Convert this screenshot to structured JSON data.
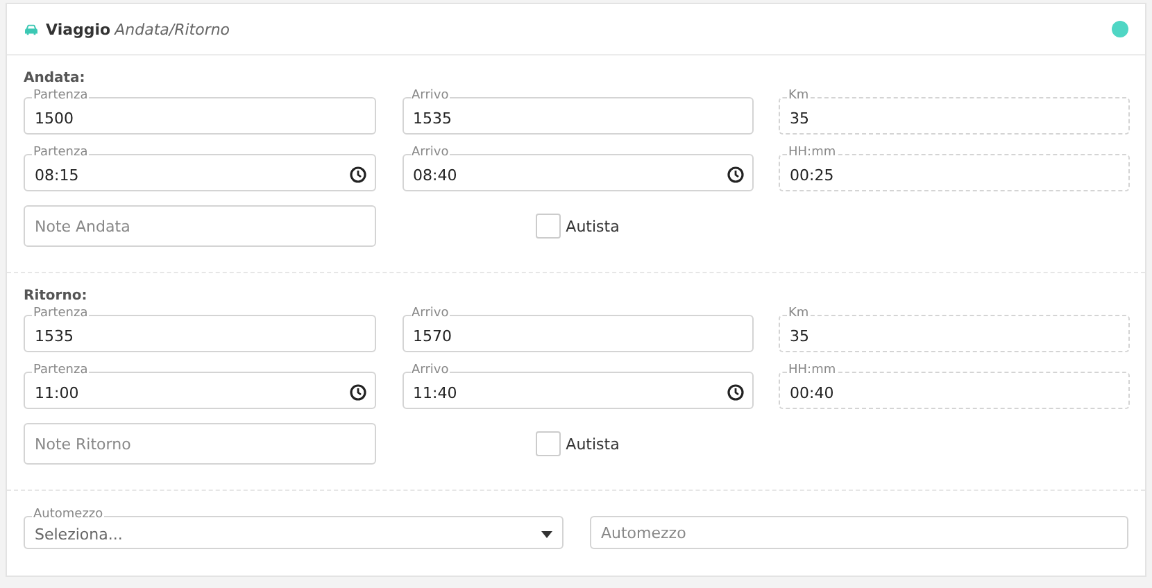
{
  "card": {
    "title": "Viaggio",
    "subtitle": "Andata/Ritorno"
  },
  "sections": [
    {
      "title": "Andata:",
      "rows": [
        [
          {
            "kind": "text",
            "label": "Partenza",
            "value": "1500"
          },
          {
            "kind": "text",
            "label": "Arrivo",
            "value": "1535"
          },
          {
            "kind": "computed",
            "label": "Km",
            "value": "35"
          }
        ],
        [
          {
            "kind": "time",
            "label": "Partenza",
            "value": "08:15"
          },
          {
            "kind": "time",
            "label": "Arrivo",
            "value": "08:40"
          },
          {
            "kind": "computed",
            "label": "HH:mm",
            "value": "00:25"
          }
        ]
      ],
      "note": {
        "placeholder": "Note Andata"
      },
      "checkbox": {
        "label": "Autista",
        "checked": false
      }
    },
    {
      "title": "Ritorno:",
      "rows": [
        [
          {
            "kind": "text",
            "label": "Partenza",
            "value": "1535"
          },
          {
            "kind": "text",
            "label": "Arrivo",
            "value": "1570"
          },
          {
            "kind": "computed",
            "label": "Km",
            "value": "35"
          }
        ],
        [
          {
            "kind": "time",
            "label": "Partenza",
            "value": "11:00"
          },
          {
            "kind": "time",
            "label": "Arrivo",
            "value": "11:40"
          },
          {
            "kind": "computed",
            "label": "HH:mm",
            "value": "00:40"
          }
        ]
      ],
      "note": {
        "placeholder": "Note Ritorno"
      },
      "checkbox": {
        "label": "Autista",
        "checked": false
      }
    }
  ],
  "vehicle": {
    "select": {
      "label": "Automezzo",
      "value": "Seleziona..."
    },
    "input": {
      "placeholder": "Automezzo"
    }
  }
}
